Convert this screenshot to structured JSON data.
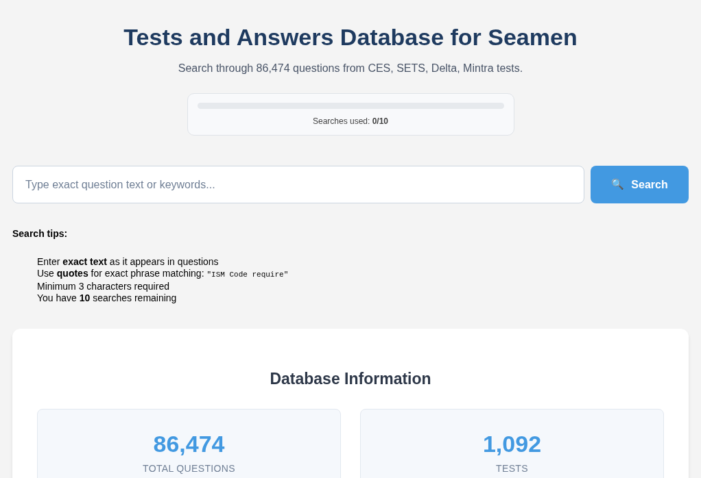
{
  "header": {
    "title": "Tests and Answers Database for Seamen",
    "subtitle": "Search through 86,474 questions from CES, SETS, Delta, Mintra tests."
  },
  "usage": {
    "level": 0,
    "label": "Searches used: **0/10**"
  },
  "search": {
    "placeholder": "Type exact question text or keywords...",
    "button": {
      "icon": "🔍",
      "label": "Search"
    }
  },
  "tips": {
    "title": "Search tips:",
    "items": [
      {
        "text": "Enter **exact text** as it appears in questions"
      },
      {
        "text": "Use **quotes** for exact phrase matching: ",
        "code": "\"ISM Code require\""
      },
      {
        "text": "Minimum 3 characters required"
      },
      {
        "text": "You have **10** searches remaining"
      }
    ]
  },
  "info": {
    "title": "Database Information",
    "stats": [
      {
        "value": "86,474",
        "label": "TOTAL QUESTIONS"
      },
      {
        "value": "1,092",
        "label": "TESTS"
      }
    ]
  }
}
